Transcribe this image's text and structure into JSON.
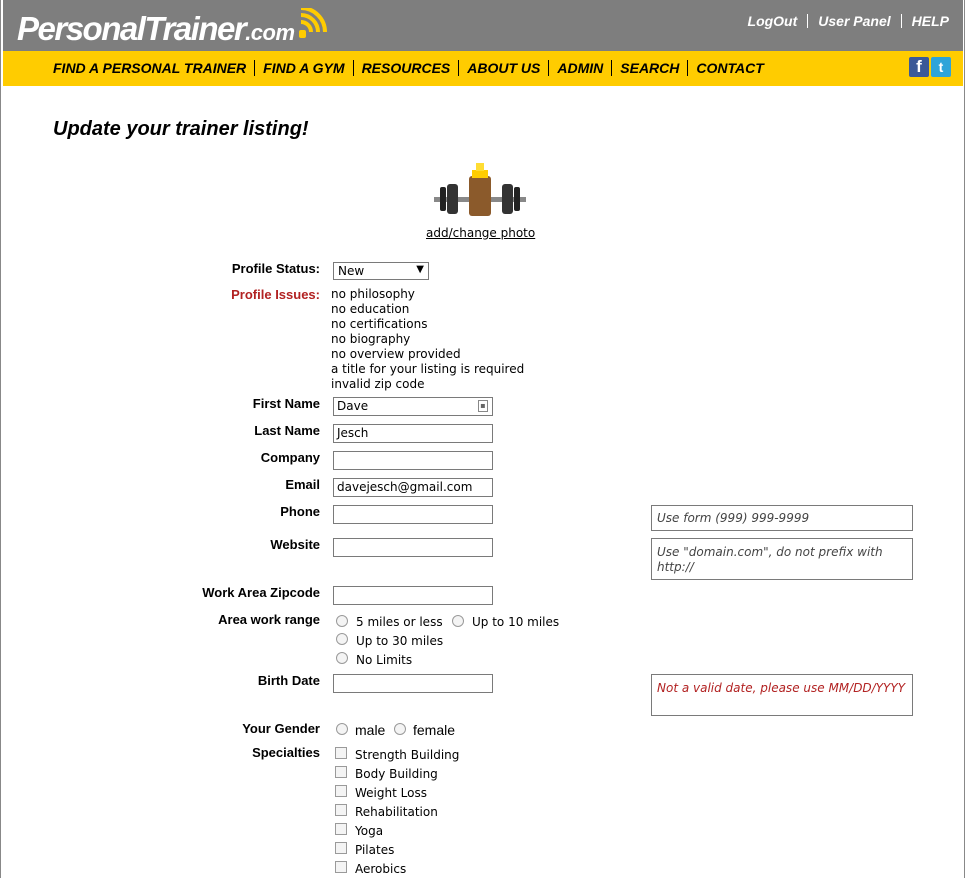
{
  "header": {
    "logo": {
      "part1": "Personal",
      "part2": "Trainer",
      "part3": ".com"
    },
    "top_links": [
      "LogOut",
      "User Panel",
      "HELP"
    ]
  },
  "nav": {
    "items": [
      "FIND A PERSONAL TRAINER",
      "FIND A GYM",
      "RESOURCES",
      "ABOUT US",
      "ADMIN",
      "SEARCH",
      "CONTACT"
    ],
    "social": {
      "facebook": "f",
      "twitter": "t"
    }
  },
  "page": {
    "title": "Update your trainer listing!"
  },
  "photo": {
    "link": "add/change photo"
  },
  "form": {
    "profile_status": {
      "label": "Profile Status:",
      "value": "New"
    },
    "profile_issues": {
      "label": "Profile Issues:",
      "items": [
        "no philosophy",
        "no education",
        "no certifications",
        "no biography",
        "no overview provided",
        "a title for your listing is required",
        "invalid zip code"
      ]
    },
    "first_name": {
      "label": "First Name",
      "value": "Dave"
    },
    "last_name": {
      "label": "Last Name",
      "value": "Jesch"
    },
    "company": {
      "label": "Company",
      "value": ""
    },
    "email": {
      "label": "Email",
      "value": "davejesch@gmail.com"
    },
    "phone": {
      "label": "Phone",
      "value": "",
      "hint": "Use form (999) 999-9999"
    },
    "website": {
      "label": "Website",
      "value": "",
      "hint": "Use \"domain.com\", do not prefix with http://"
    },
    "zipcode": {
      "label": "Work Area Zipcode",
      "value": ""
    },
    "work_range": {
      "label": "Area work range",
      "options": [
        "5 miles or less",
        "Up to 10 miles",
        "Up to 30 miles",
        "No Limits"
      ]
    },
    "birth_date": {
      "label": "Birth Date",
      "value": "",
      "error": "Not a valid date, please use MM/DD/YYYY"
    },
    "gender": {
      "label": "Your Gender",
      "options": [
        "male",
        "female"
      ]
    },
    "specialties": {
      "label": "Specialties",
      "options": [
        "Strength Building",
        "Body Building",
        "Weight Loss",
        "Rehabilitation",
        "Yoga",
        "Pilates",
        "Aerobics"
      ]
    }
  },
  "colors": {
    "header_gray": "#7e7e7e",
    "nav_yellow": "#ffcc00",
    "issue_red": "#b22222"
  }
}
